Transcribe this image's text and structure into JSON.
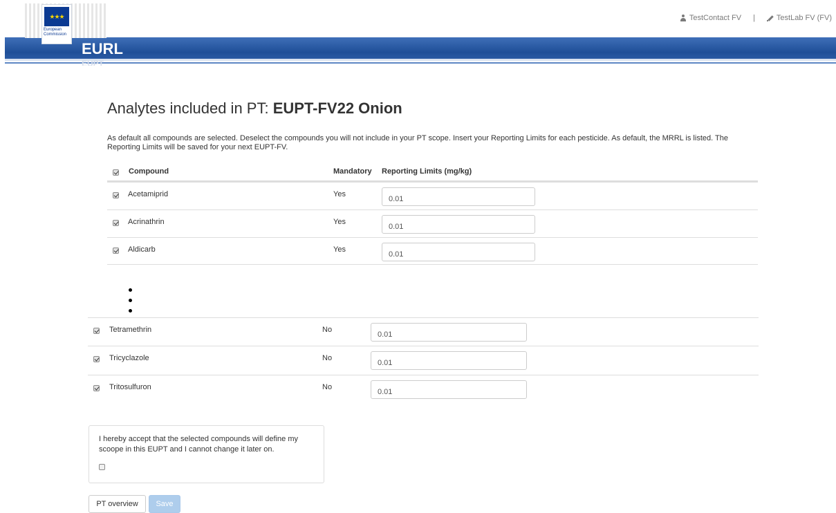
{
  "header": {
    "org_line1": "European",
    "org_line2": "Commission",
    "brand": "EURL",
    "brand_sub": "EUPT",
    "user_contact": "TestContact FV",
    "separator": "|",
    "user_lab": "TestLab FV (FV)"
  },
  "page": {
    "title_prefix": "Analytes included in PT:",
    "title_bold": "EUPT-FV22 Onion",
    "intro": "As default all compounds are selected. Deselect the compounds you will not include in your PT scope. Insert your Reporting Limits for each pesticide. As default, the MRRL is listed. The Reporting Limits will be saved for your next EUPT-FV."
  },
  "table": {
    "col_compound": "Compound",
    "col_mandatory": "Mandatory",
    "col_limits": "Reporting Limits (mg/kg)",
    "rows_top": [
      {
        "compound": "Acetamiprid",
        "mandatory": "Yes",
        "limit": "0.01"
      },
      {
        "compound": "Acrinathrin",
        "mandatory": "Yes",
        "limit": "0.01"
      },
      {
        "compound": "Aldicarb",
        "mandatory": "Yes",
        "limit": "0.01"
      }
    ],
    "rows_bottom": [
      {
        "compound": "Tetramethrin",
        "mandatory": "No",
        "limit": "0.01"
      },
      {
        "compound": "Tricyclazole",
        "mandatory": "No",
        "limit": "0.01"
      },
      {
        "compound": "Tritosulfuron",
        "mandatory": "No",
        "limit": "0.01"
      }
    ]
  },
  "accept": {
    "text": "I hereby accept that the selected compounds will define my scoope in this EUPT and I cannot change it later on."
  },
  "buttons": {
    "overview": "PT overview",
    "save": "Save"
  }
}
